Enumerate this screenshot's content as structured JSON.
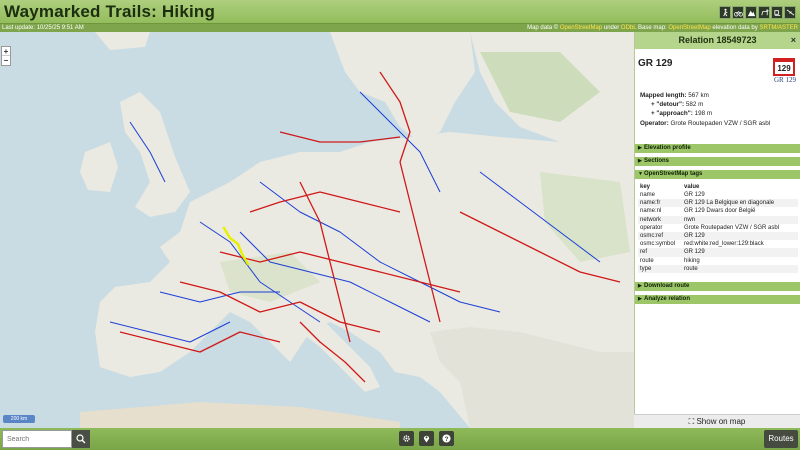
{
  "app": {
    "title": "Waymarked Trails: Hiking"
  },
  "status": {
    "last_update": "Last update: 10/25/25 9:51 AM",
    "attr_prefix": "Map data © ",
    "attr_osm": "OpenStreetMap",
    "attr_under": " under ",
    "attr_odbl": "ODbL",
    "attr_base": " Base map: ",
    "attr_osm2": "OpenStreetMap",
    "attr_elev": " elevation data by ",
    "attr_srtm": "SRTM/ASTER"
  },
  "theme_icons": [
    "hiking-icon",
    "cycling-icon",
    "mtb-icon",
    "riding-icon",
    "skating-icon",
    "slopes-icon"
  ],
  "map": {
    "zoom_in": "+",
    "zoom_out": "−",
    "scale": "200 km"
  },
  "panel": {
    "title": "Relation 18549723",
    "close": "×",
    "route_name": "GR 129",
    "symbol_text": "129",
    "symbol_caption": "GR 129",
    "info": {
      "length_label": "Mapped length:",
      "length_value": "567 km",
      "detour_label": "+ \"detour\":",
      "detour_value": "582 m",
      "approach_label": "+ \"approach\":",
      "approach_value": "198 m",
      "operator_label": "Operator:",
      "operator_value": "Grote Routepaden VZW / SGR asbl"
    },
    "sections": {
      "elevation": "Elevation profile",
      "sections": "Sections",
      "osm_tags": "OpenStreetMap tags",
      "download": "Download route",
      "analyze": "Analyze relation"
    },
    "tags": {
      "key_header": "key",
      "value_header": "value",
      "rows": [
        [
          "name",
          "GR 129"
        ],
        [
          "name:fr",
          "GR 129 La Belgique en diagonale"
        ],
        [
          "name:nl",
          "GR 129 Dwars door België"
        ],
        [
          "network",
          "nwn"
        ],
        [
          "operator",
          "Grote Routepaden VZW / SGR asbl"
        ],
        [
          "osmc:ref",
          "GR 129"
        ],
        [
          "osmc:symbol",
          "red:white:red_lower:129:black"
        ],
        [
          "ref",
          "GR 129"
        ],
        [
          "route",
          "hiking"
        ],
        [
          "type",
          "route"
        ]
      ]
    },
    "show_on_map": "Show on map"
  },
  "footer": {
    "search_placeholder": "Search",
    "routes": "Routes"
  },
  "colors": {
    "accent": "#9cc668",
    "route_red": "#d01818",
    "route_blue": "#1b3fd8",
    "highlight": "#e8f000"
  }
}
